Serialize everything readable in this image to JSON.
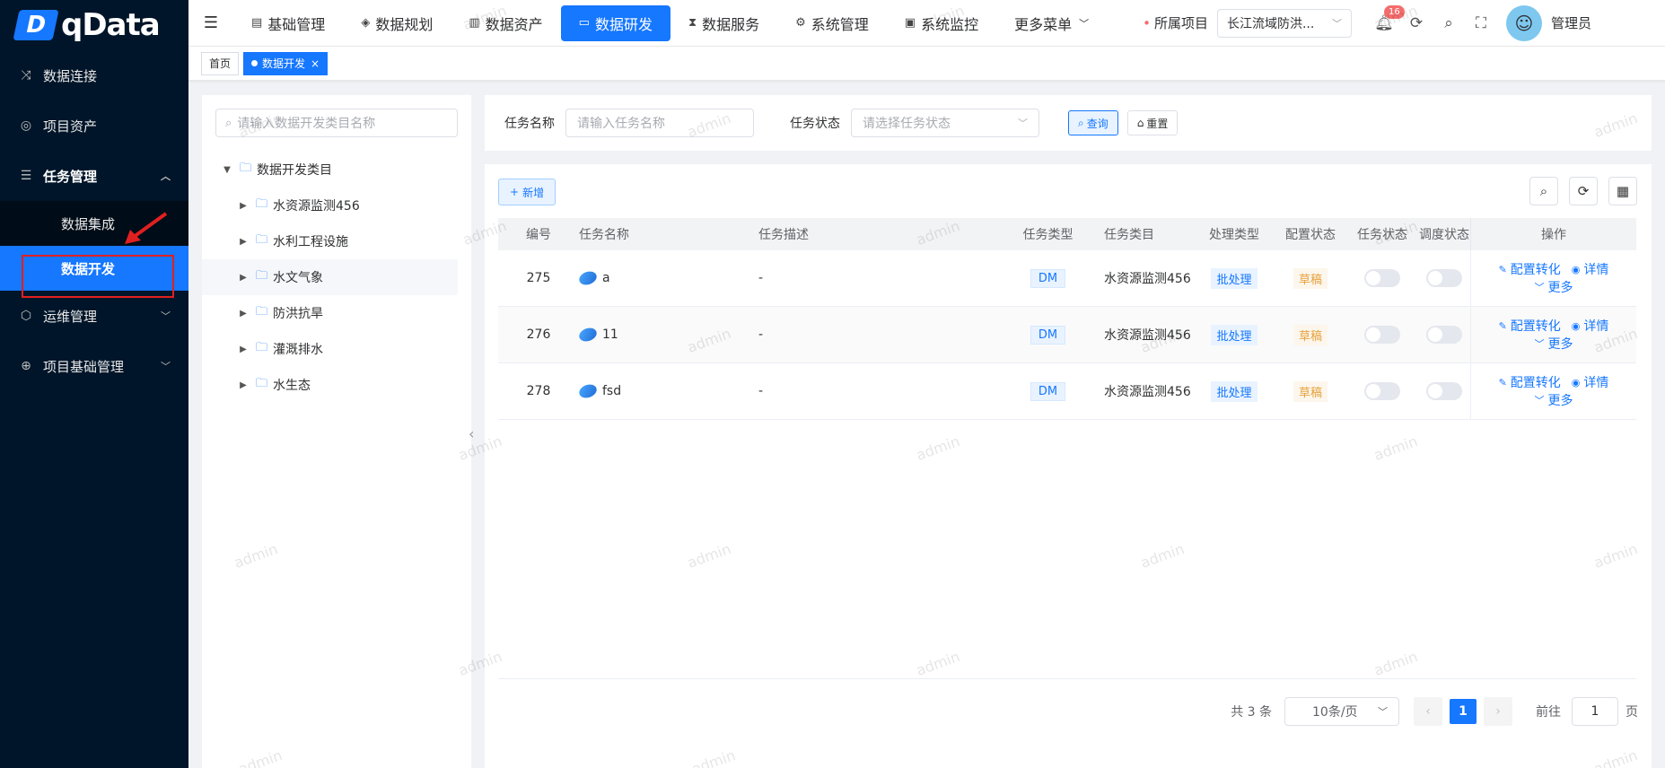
{
  "app": {
    "logo_mark": "D",
    "logo_text": "qData"
  },
  "sidebar": {
    "items": [
      {
        "label": "数据连接",
        "icon": "shuffle-icon"
      },
      {
        "label": "项目资产",
        "icon": "target-icon"
      },
      {
        "label": "任务管理",
        "icon": "list-icon",
        "open": true,
        "children": [
          {
            "label": "数据集成"
          },
          {
            "label": "数据开发",
            "active": true
          }
        ]
      },
      {
        "label": "运维管理",
        "icon": "cube-icon"
      },
      {
        "label": "项目基础管理",
        "icon": "globe-icon"
      }
    ]
  },
  "topnav": {
    "items": [
      {
        "label": "基础管理",
        "icon": "doc-icon"
      },
      {
        "label": "数据规划",
        "icon": "layers-icon"
      },
      {
        "label": "数据资产",
        "icon": "book-icon"
      },
      {
        "label": "数据研发",
        "icon": "window-icon",
        "active": true
      },
      {
        "label": "数据服务",
        "icon": "hourglass-icon"
      },
      {
        "label": "系统管理",
        "icon": "settings-icon"
      },
      {
        "label": "系统监控",
        "icon": "monitor-icon"
      },
      {
        "label": "更多菜单",
        "icon": ""
      }
    ],
    "project_label": "所属项目",
    "project_value": "长江流域防洪...",
    "notification_count": "16",
    "username": "管理员"
  },
  "tags": {
    "home": "首页",
    "current": "数据开发"
  },
  "tree": {
    "search_placeholder": "请输入数据开发类目名称",
    "root": "数据开发类目",
    "children": [
      "水资源监测456",
      "水利工程设施",
      "水文气象",
      "防洪抗旱",
      "灌溉排水",
      "水生态"
    ]
  },
  "query": {
    "name_label": "任务名称",
    "name_placeholder": "请输入任务名称",
    "status_label": "任务状态",
    "status_placeholder": "请选择任务状态",
    "query_btn": "查询",
    "reset_btn": "重置"
  },
  "table": {
    "add_btn": "新增",
    "headers": [
      "编号",
      "任务名称",
      "任务描述",
      "任务类型",
      "任务类目",
      "处理类型",
      "配置状态",
      "任务状态",
      "调度状态",
      "操作"
    ],
    "rows": [
      {
        "id": "275",
        "name": "a",
        "desc": "-",
        "type": "DM",
        "category": "水资源监测456",
        "proc": "批处理",
        "conf": "草稿",
        "status_on": false,
        "sched_on": false
      },
      {
        "id": "276",
        "name": "11",
        "desc": "-",
        "type": "DM",
        "category": "水资源监测456",
        "proc": "批处理",
        "conf": "草稿",
        "status_on": false,
        "sched_on": false
      },
      {
        "id": "278",
        "name": "fsd",
        "desc": "-",
        "type": "DM",
        "category": "水资源监测456",
        "proc": "批处理",
        "conf": "草稿",
        "status_on": false,
        "sched_on": false
      }
    ],
    "ops": {
      "convert": "配置转化",
      "detail": "详情",
      "more": "更多"
    }
  },
  "pager": {
    "total": "共 3 条",
    "page_size": "10条/页",
    "current": "1",
    "goto_label": "前往",
    "goto_value": "1",
    "page_suffix": "页"
  },
  "watermark": "admin",
  "colors": {
    "primary": "#1677ff",
    "sidebar_bg": "#001529",
    "danger": "#f56c6c",
    "warning": "#e6a23c"
  }
}
